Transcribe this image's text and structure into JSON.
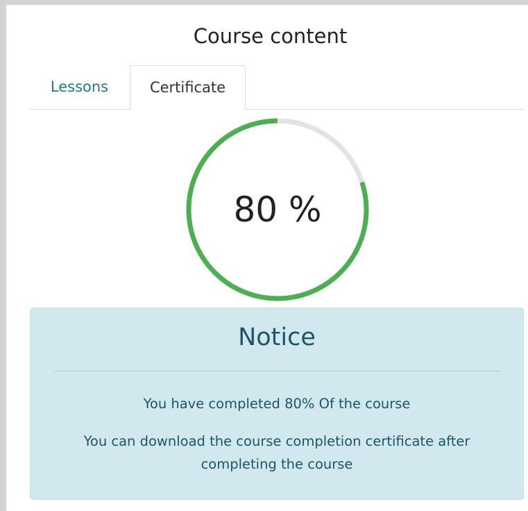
{
  "header": {
    "title": "Course content"
  },
  "tabs": [
    {
      "label": "Lessons",
      "active": false
    },
    {
      "label": "Certificate",
      "active": true
    }
  ],
  "progress": {
    "percent": 80,
    "label": "80 %",
    "track_color": "#e3e3e3",
    "fill_color": "#4caf50"
  },
  "notice": {
    "title": "Notice",
    "line1": "You have completed 80% Of the course",
    "line2": "You can download the course completion certificate after completing the course",
    "background_color": "#d1e9ee"
  }
}
